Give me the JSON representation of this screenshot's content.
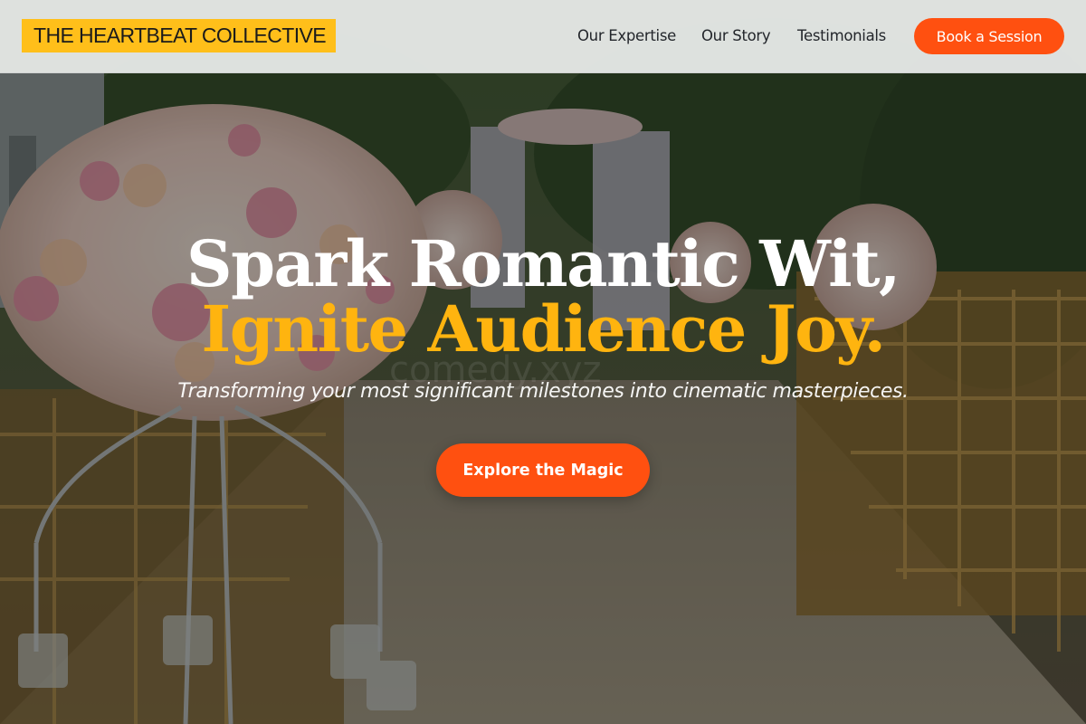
{
  "brand": {
    "name": "THE HEARTBEAT COLLECTIVE"
  },
  "nav": {
    "items": [
      {
        "label": "Our Expertise"
      },
      {
        "label": "Our Story"
      },
      {
        "label": "Testimonials"
      }
    ],
    "cta_label": "Book a Session"
  },
  "hero": {
    "headline_line1": "Spark Romantic Wit,",
    "headline_line2": "Ignite Audience Joy.",
    "tagline": "Transforming your most significant milestones into cinematic masterpieces.",
    "cta_label": "Explore the Magic",
    "watermark": "comedy.xyz"
  },
  "colors": {
    "brand_yellow": "#ffbf1a",
    "accent_orange": "#ff5010",
    "headline_gold": "#ffb40f",
    "header_bg": "#eef0ef"
  }
}
